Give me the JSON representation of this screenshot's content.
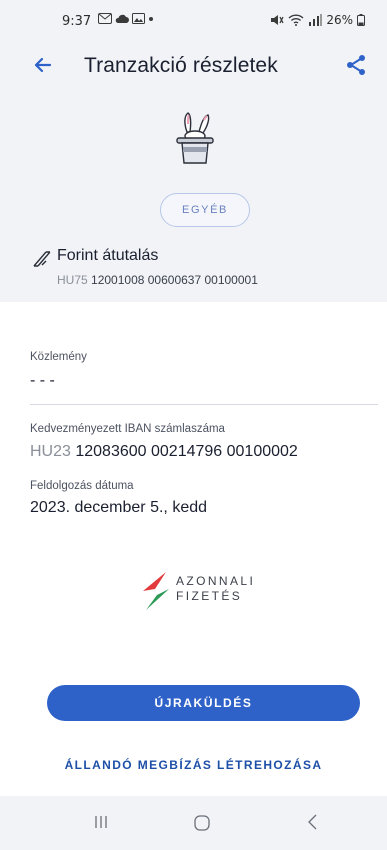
{
  "status_bar": {
    "time": "9:37",
    "battery": "26%"
  },
  "header": {
    "title": "Tranzakció részletek",
    "back_icon": "arrow-left-icon",
    "share_icon": "share-icon"
  },
  "category": {
    "label": "EGYÉB",
    "illustration_icon": "magic-hat-rabbit-icon"
  },
  "transfer": {
    "type": "Forint átutalás",
    "account_prefix": "HU75",
    "account_number": "12001008 00600637 00100001"
  },
  "fields": {
    "comment_label": "Közlemény",
    "comment_value": "- - -",
    "beneficiary_iban_label": "Kedvezményezett IBAN számlaszáma",
    "beneficiary_iban_prefix": "HU23",
    "beneficiary_iban_number": "12083600 00214796 00100002",
    "processing_date_label": "Feldolgozás dátuma",
    "processing_date_value": "2023. december 5., kedd"
  },
  "instant_payment_logo": {
    "line1": "AZONNALI",
    "line2": "FIZETÉS"
  },
  "actions": {
    "resend_label": "ÚJRAKÜLDÉS",
    "standing_order_label": "ÁLLANDÓ MEGBÍZÁS LÉTREHOZÁSA"
  },
  "colors": {
    "primary": "#2f62c9",
    "link": "#1e4fa8",
    "header_background": "#f1f3f7",
    "logo_red": "#e23b3b",
    "logo_green": "#2e9a57"
  }
}
